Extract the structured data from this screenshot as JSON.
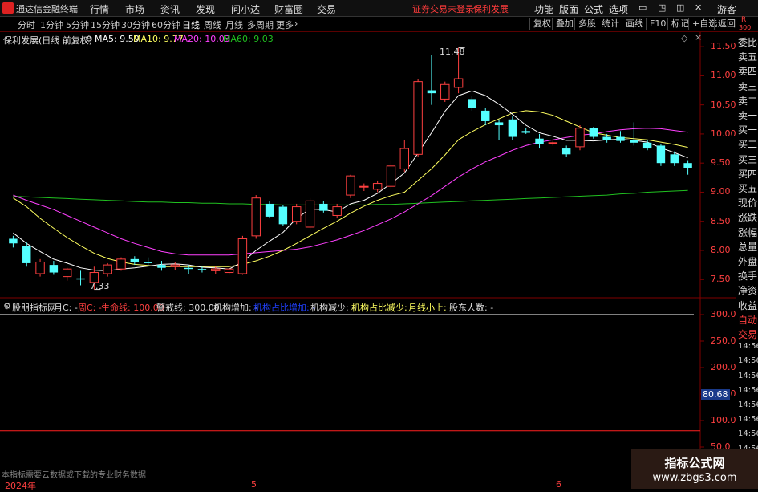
{
  "app": {
    "name": "通达信金融终端",
    "warning": "证券交易未登录",
    "stock_name_tag": "保利发展",
    "user": "游客"
  },
  "menu": [
    "行情",
    "市场",
    "资讯",
    "发现",
    "问小达",
    "财富圈",
    "交易"
  ],
  "menu_right": [
    "功能",
    "版面",
    "公式",
    "选项"
  ],
  "periods": [
    "分时",
    "1分钟",
    "5分钟",
    "15分钟",
    "30分钟",
    "60分钟",
    "日线",
    "周线",
    "月线",
    "多周期",
    "更多"
  ],
  "active_period": "日线",
  "right_buttons": [
    "复权",
    "叠加",
    "多股",
    "统计",
    "画线",
    "F10",
    "标记",
    "+自选",
    "返回"
  ],
  "header": {
    "stock": "保利发展(日线 前复权)",
    "ma5": "MA5: 9.59",
    "ma10": "MA10: 9.77",
    "ma20": "MA20: 10.03",
    "ma60": "MA60: 9.03"
  },
  "indicator_header": {
    "name": "股朋指标网",
    "month": "月C: -",
    "week": "周C: -",
    "life": "生命线: 100.00",
    "alert": "警戒线: 300.00",
    "inst_up": "机构增加: -",
    "inst_ratio_up": "机构占比增加: -",
    "inst_down": "机构减少: -",
    "inst_ratio_down": "机构占比减少: -",
    "month_up": "月线小上: -",
    "holders": "股东人数: -"
  },
  "price_axis": [
    "11.50",
    "11.00",
    "10.50",
    "10.00",
    "9.50",
    "9.00",
    "8.50",
    "8.00",
    "7.50"
  ],
  "ind_axis": [
    "300.0",
    "250.0",
    "200.0",
    "150.0",
    "100.0",
    "50.0"
  ],
  "ind_current": "80.68",
  "annotations": {
    "high": "11.48",
    "low": "7.33"
  },
  "sidepanel": [
    "委比",
    "卖五",
    "卖四",
    "卖三",
    "卖二",
    "卖一",
    "买一",
    "买二",
    "买三",
    "买四",
    "买五",
    "现价",
    "涨跌",
    "涨幅",
    "总量",
    "外盘",
    "换手",
    "净资",
    "收益",
    "自动",
    "交易",
    "14:56",
    "14:56",
    "14:56",
    "14:56",
    "14:56",
    "14:56",
    "14:56",
    "14:56",
    "14:56",
    "14:56"
  ],
  "side_top": {
    "r": "R",
    "n": "300"
  },
  "xaxis": [
    "2024年",
    "5",
    "6"
  ],
  "footnote": "本指标需要云数据或下载的专业财务数据",
  "watermark": {
    "line1": "指标公式网",
    "line2": "www.zbgs3.com"
  },
  "colors": {
    "up": "#ff4040",
    "down": "#54ffff",
    "ma5": "#ffffff",
    "ma10": "#ffff60",
    "ma20": "#ff40ff",
    "ma60": "#20c020",
    "axis": "#800000"
  },
  "chart_data": {
    "type": "candlestick",
    "price_range": [
      7.2,
      11.75
    ],
    "candles": [
      [
        8.2,
        8.25,
        8.05,
        8.12
      ],
      [
        8.08,
        8.15,
        7.72,
        7.78
      ],
      [
        7.6,
        7.85,
        7.55,
        7.8
      ],
      [
        7.75,
        7.82,
        7.58,
        7.62
      ],
      [
        7.55,
        7.7,
        7.48,
        7.68
      ],
      [
        7.52,
        7.65,
        7.4,
        7.5
      ],
      [
        7.45,
        7.72,
        7.33,
        7.62
      ],
      [
        7.6,
        7.78,
        7.55,
        7.75
      ],
      [
        7.68,
        7.88,
        7.65,
        7.85
      ],
      [
        7.85,
        7.9,
        7.75,
        7.8
      ],
      [
        7.8,
        7.88,
        7.72,
        7.78
      ],
      [
        7.75,
        7.82,
        7.65,
        7.7
      ],
      [
        7.72,
        7.8,
        7.66,
        7.75
      ],
      [
        7.7,
        7.75,
        7.6,
        7.68
      ],
      [
        7.68,
        7.72,
        7.62,
        7.66
      ],
      [
        7.65,
        7.72,
        7.6,
        7.68
      ],
      [
        7.62,
        7.7,
        7.58,
        7.68
      ],
      [
        7.6,
        8.25,
        7.58,
        8.2
      ],
      [
        8.25,
        8.95,
        8.2,
        8.9
      ],
      [
        8.8,
        8.85,
        8.55,
        8.58
      ],
      [
        8.75,
        8.78,
        8.42,
        8.45
      ],
      [
        8.5,
        8.8,
        8.45,
        8.75
      ],
      [
        8.4,
        8.9,
        8.35,
        8.85
      ],
      [
        8.8,
        8.85,
        8.65,
        8.68
      ],
      [
        8.6,
        8.8,
        8.55,
        8.75
      ],
      [
        8.95,
        9.3,
        8.9,
        9.28
      ],
      [
        9.1,
        9.15,
        9.02,
        9.1
      ],
      [
        9.05,
        9.2,
        9.0,
        9.15
      ],
      [
        9.1,
        9.55,
        9.05,
        9.45
      ],
      [
        9.4,
        9.9,
        9.35,
        9.75
      ],
      [
        9.65,
        10.95,
        9.6,
        10.9
      ],
      [
        10.75,
        11.35,
        10.5,
        10.7
      ],
      [
        10.6,
        10.9,
        10.55,
        10.85
      ],
      [
        10.8,
        11.48,
        10.7,
        10.95
      ],
      [
        10.6,
        10.65,
        10.4,
        10.45
      ],
      [
        10.4,
        10.45,
        10.15,
        10.22
      ],
      [
        10.2,
        10.25,
        9.9,
        10.15
      ],
      [
        10.25,
        10.3,
        9.9,
        9.95
      ],
      [
        10.05,
        10.1,
        10.0,
        10.02
      ],
      [
        9.92,
        10.0,
        9.75,
        9.82
      ],
      [
        9.85,
        9.9,
        9.8,
        9.85
      ],
      [
        9.75,
        9.8,
        9.6,
        9.65
      ],
      [
        9.78,
        10.15,
        9.72,
        10.1
      ],
      [
        10.1,
        10.12,
        9.92,
        9.95
      ],
      [
        9.95,
        10.0,
        9.85,
        9.9
      ],
      [
        9.95,
        10.05,
        9.85,
        9.88
      ],
      [
        9.9,
        10.2,
        9.8,
        9.85
      ],
      [
        9.85,
        9.9,
        9.72,
        9.75
      ],
      [
        9.8,
        9.82,
        9.45,
        9.5
      ],
      [
        9.65,
        9.7,
        9.45,
        9.5
      ],
      [
        9.5,
        9.55,
        9.3,
        9.42
      ]
    ],
    "ma5": [
      8.3,
      8.12,
      7.98,
      7.85,
      7.78,
      7.7,
      7.66,
      7.65,
      7.68,
      7.7,
      7.73,
      7.76,
      7.77,
      7.75,
      7.71,
      7.7,
      7.68,
      7.8,
      8.0,
      8.16,
      8.31,
      8.55,
      8.71,
      8.7,
      8.66,
      8.8,
      8.86,
      8.98,
      9.15,
      9.33,
      9.67,
      10.02,
      10.39,
      10.66,
      10.74,
      10.66,
      10.51,
      10.34,
      10.15,
      10.02,
      9.96,
      9.89,
      9.89,
      9.88,
      9.9,
      9.91,
      9.89,
      9.86,
      9.76,
      9.68,
      9.59
    ],
    "ma10": [
      8.9,
      8.75,
      8.55,
      8.38,
      8.22,
      8.08,
      7.95,
      7.86,
      7.8,
      7.76,
      7.74,
      7.72,
      7.72,
      7.72,
      7.72,
      7.72,
      7.72,
      7.76,
      7.82,
      7.9,
      8.0,
      8.12,
      8.25,
      8.38,
      8.5,
      8.64,
      8.76,
      8.86,
      8.94,
      9.0,
      9.2,
      9.4,
      9.64,
      9.9,
      10.04,
      10.16,
      10.26,
      10.36,
      10.4,
      10.38,
      10.32,
      10.22,
      10.12,
      10.02,
      9.98,
      9.94,
      9.92,
      9.9,
      9.86,
      9.82,
      9.77
    ],
    "ma20": [
      8.95,
      8.86,
      8.78,
      8.7,
      8.6,
      8.5,
      8.4,
      8.3,
      8.2,
      8.12,
      8.05,
      7.98,
      7.94,
      7.92,
      7.92,
      7.92,
      7.92,
      7.94,
      7.96,
      7.98,
      8.0,
      8.02,
      8.06,
      8.12,
      8.18,
      8.26,
      8.34,
      8.44,
      8.54,
      8.66,
      8.8,
      8.94,
      9.1,
      9.26,
      9.4,
      9.52,
      9.62,
      9.72,
      9.8,
      9.86,
      9.9,
      9.94,
      9.98,
      10.0,
      10.04,
      10.07,
      10.09,
      10.1,
      10.09,
      10.06,
      10.03
    ],
    "ma60": [
      8.93,
      8.92,
      8.91,
      8.9,
      8.89,
      8.88,
      8.87,
      8.86,
      8.85,
      8.84,
      8.83,
      8.83,
      8.82,
      8.82,
      8.81,
      8.81,
      8.8,
      8.8,
      8.79,
      8.79,
      8.78,
      8.78,
      8.78,
      8.78,
      8.78,
      8.78,
      8.78,
      8.79,
      8.79,
      8.8,
      8.81,
      8.82,
      8.83,
      8.84,
      8.85,
      8.86,
      8.87,
      8.88,
      8.89,
      8.9,
      8.91,
      8.92,
      8.93,
      8.94,
      8.95,
      8.97,
      8.98,
      9.0,
      9.01,
      9.02,
      9.03
    ]
  }
}
